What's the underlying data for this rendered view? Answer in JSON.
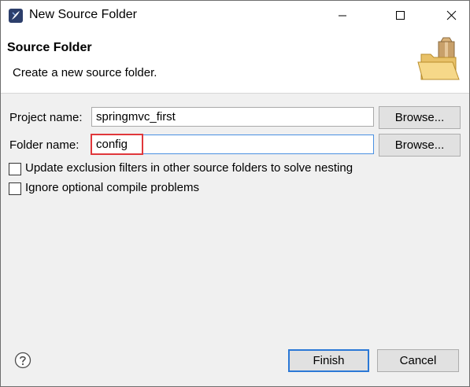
{
  "window": {
    "title": "New Source Folder",
    "icon": "eclipse-app-icon",
    "controls": {
      "minimize": "minimize-icon",
      "maximize": "maximize-icon",
      "close": "close-icon"
    }
  },
  "header": {
    "title": "Source Folder",
    "description": "Create a new source folder.",
    "image": "folder-package-icon"
  },
  "form": {
    "project_label": "Project name:",
    "project_value": "springmvc_first",
    "project_browse": "Browse...",
    "folder_label": "Folder name:",
    "folder_value": "config",
    "folder_browse": "Browse...",
    "options": [
      {
        "label": "Update exclusion filters in other source folders to solve nesting",
        "checked": false
      },
      {
        "label": "Ignore optional compile problems",
        "checked": false
      }
    ]
  },
  "footer": {
    "help_icon": "help-icon",
    "finish": "Finish",
    "cancel": "Cancel"
  },
  "colors": {
    "highlight": "#e0373b",
    "focus": "#4a90e2",
    "default_button_border": "#2b78d6"
  }
}
